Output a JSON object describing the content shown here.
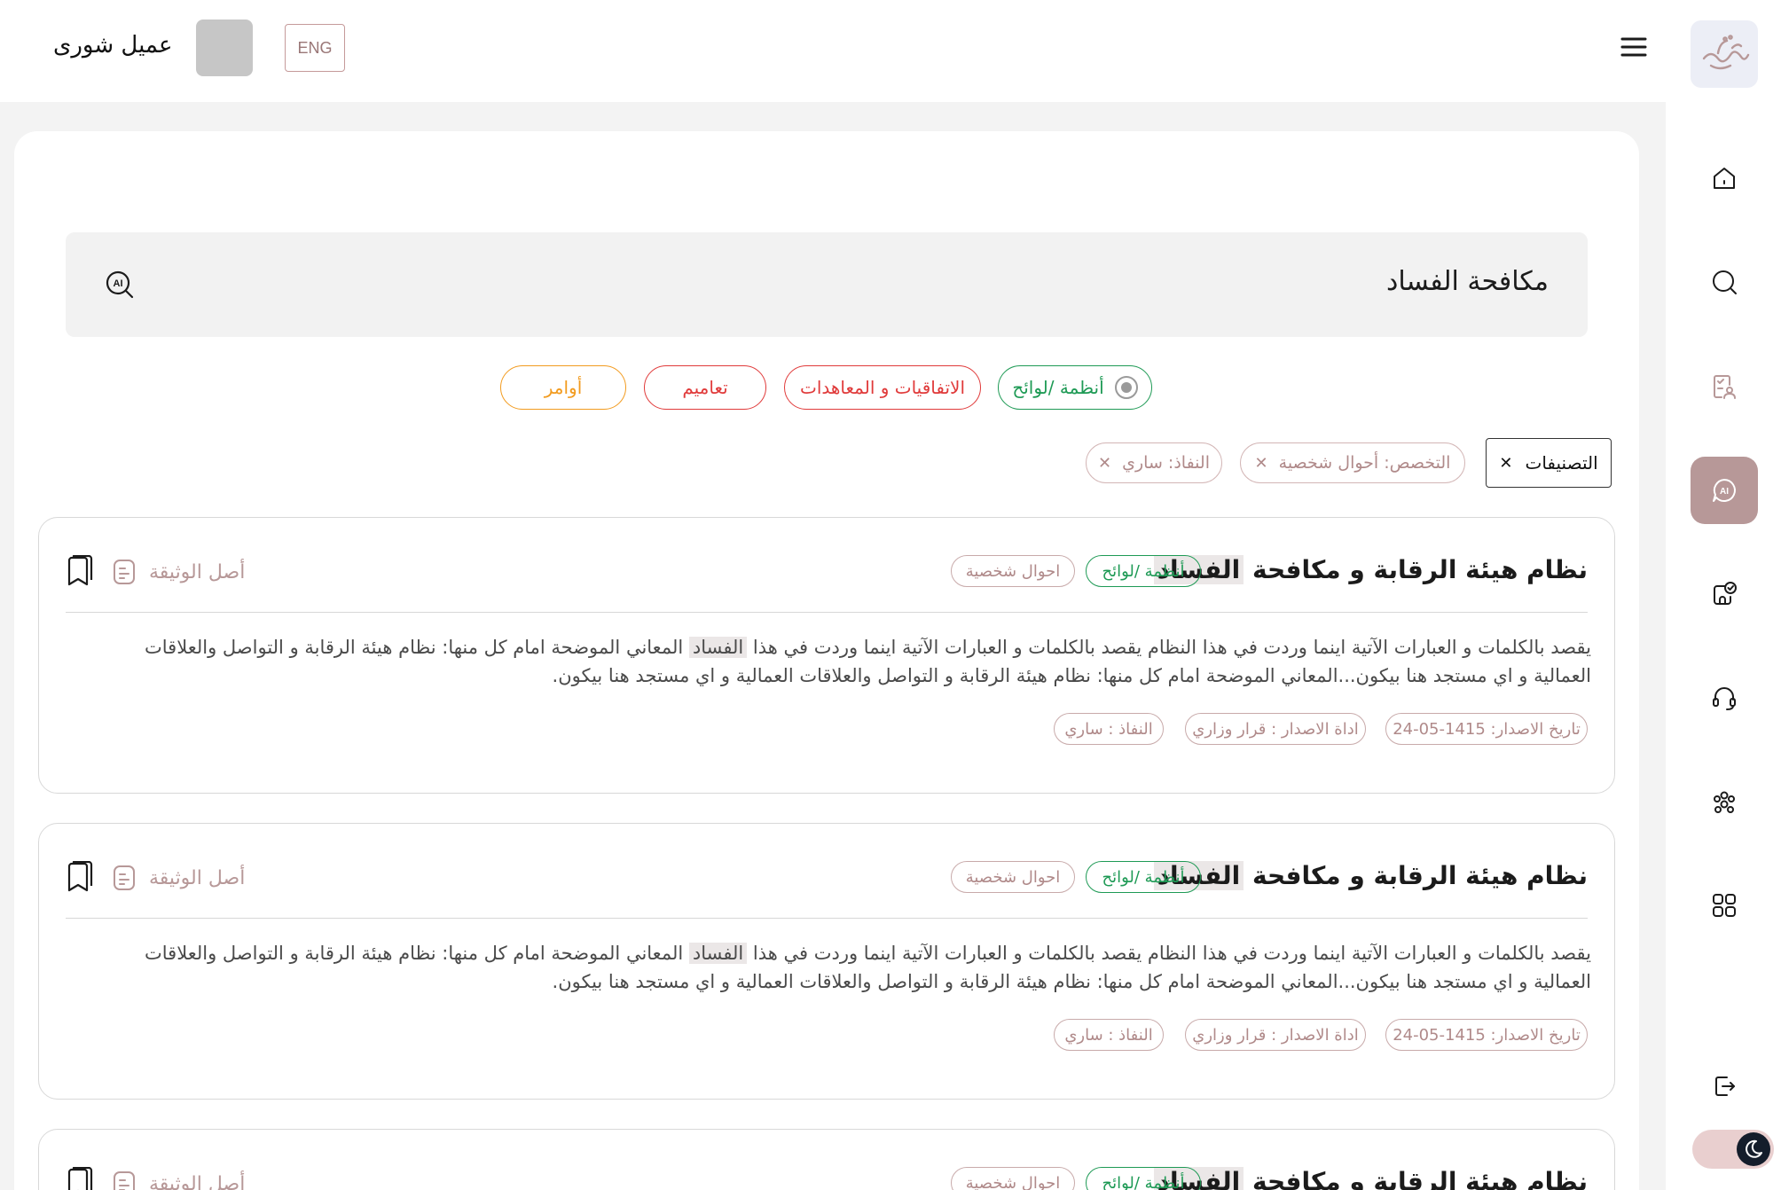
{
  "header": {
    "user_name": "عميل شورى",
    "lang_label": "ENG"
  },
  "sidebar": {
    "items": [
      {
        "icon": "home-icon"
      },
      {
        "icon": "search-icon"
      },
      {
        "icon": "document-check-icon"
      },
      {
        "icon": "ai-chat-icon",
        "active": true
      },
      {
        "icon": "clipboard-check-icon"
      },
      {
        "icon": "headset-icon"
      },
      {
        "icon": "people-group-icon"
      },
      {
        "icon": "grid-apps-icon"
      },
      {
        "icon": "logout-icon"
      }
    ],
    "theme_mode": "dark"
  },
  "search": {
    "query": "مكافحة الفساد"
  },
  "categories": [
    {
      "label": "أنظمة /لوائح",
      "color": "#1e9a55",
      "selected": true
    },
    {
      "label": "الاتفاقيات و المعاهدات",
      "color": "#e03a3a"
    },
    {
      "label": "تعاميم",
      "color": "#e03a3a"
    },
    {
      "label": "أوامر",
      "color": "#f29b1f"
    }
  ],
  "filters": {
    "main_label": "التصنيفات",
    "chips": [
      {
        "label": "التخصص: أحوال شخصية"
      },
      {
        "label": "النفاذ: ساري"
      }
    ]
  },
  "results": [
    {
      "title_pre": "نظام هيئة الرقابة و مكافحة ",
      "title_hl": "الفساد",
      "category_tag": "أنظمة /لوائح",
      "specialty_tag": "احوال شخصية",
      "original_label": "أصل الوثيقة",
      "body_pre": "يقصد بالكلمات و العبارات الآتية اينما وردت في هذا النظام يقصد بالكلمات و العبارات الآتية اينما وردت في هذا ",
      "body_hl": "الفساد",
      "body_post": " المعاني الموضحة امام كل منها: نظام هيئة الرقابة و التواصل والعلاقات العمالية و اي مستجد هنا بيكون...المعاني الموضحة امام كل منها: نظام هيئة الرقابة و التواصل والعلاقات العمالية و اي مستجد هنا بيكون.",
      "issue_date": "تاريخ الاصدار: 1415-05-24",
      "issue_tool": "اداة الاصدار : قرار وزاري",
      "status": "النفاذ : ساري"
    },
    {
      "title_pre": "نظام هيئة الرقابة و مكافحة ",
      "title_hl": "الفساد",
      "category_tag": "أنظمة /لوائح",
      "specialty_tag": "احوال شخصية",
      "original_label": "أصل الوثيقة",
      "body_pre": "يقصد بالكلمات و العبارات الآتية اينما وردت في هذا النظام يقصد بالكلمات و العبارات الآتية اينما وردت في هذا ",
      "body_hl": "الفساد",
      "body_post": " المعاني الموضحة امام كل منها: نظام هيئة الرقابة و التواصل والعلاقات العمالية و اي مستجد هنا بيكون...المعاني الموضحة امام كل منها: نظام هيئة الرقابة و التواصل والعلاقات العمالية و اي مستجد هنا بيكون.",
      "issue_date": "تاريخ الاصدار: 1415-05-24",
      "issue_tool": "اداة الاصدار : قرار وزاري",
      "status": "النفاذ : ساري"
    },
    {
      "title_pre": "نظام هيئة الرقابة و مكافحة ",
      "title_hl": "الفساد",
      "category_tag": "أنظمة /لوائح",
      "specialty_tag": "احوال شخصية",
      "original_label": "أصل الوثيقة"
    }
  ]
}
